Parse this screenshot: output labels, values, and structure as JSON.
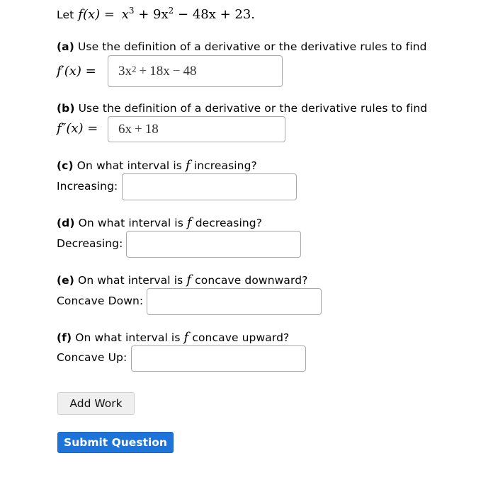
{
  "problem": {
    "intro": "Let",
    "function_lhs": "f(x) =",
    "function_rhs": {
      "t1": "x",
      "t1_exp": "3",
      "t2": "+ 9x",
      "t2_exp": "2",
      "t3": "− 48x + 23."
    }
  },
  "parts": [
    {
      "letter": "(a)",
      "prompt": "Use the definition of a derivative or the derivative rules to find",
      "label": "f′(x) =",
      "answer": {
        "a": "3x",
        "a_exp": "2",
        "op1": "+",
        "b": "18x",
        "op2": "−",
        "c": "48"
      }
    },
    {
      "letter": "(b)",
      "prompt": "Use the definition of a derivative or the derivative rules to find",
      "label": "f″(x) =",
      "answer": {
        "a": "6x",
        "op1": "+",
        "b": "18"
      }
    },
    {
      "letter": "(c)",
      "prompt_pre": "On what interval is",
      "prompt_var": "f",
      "prompt_post": "increasing?",
      "label": "Increasing:",
      "value": ""
    },
    {
      "letter": "(d)",
      "prompt_pre": "On what interval is",
      "prompt_var": "f",
      "prompt_post": "decreasing?",
      "label": "Decreasing:",
      "value": ""
    },
    {
      "letter": "(e)",
      "prompt_pre": "On what interval is",
      "prompt_var": "f",
      "prompt_post": "concave downward?",
      "label": "Concave Down:",
      "value": ""
    },
    {
      "letter": "(f)",
      "prompt_pre": "On what interval is",
      "prompt_var": "f",
      "prompt_post": "concave upward?",
      "label": "Concave Up:",
      "value": ""
    }
  ],
  "buttons": {
    "add_work": "Add Work",
    "submit": "Submit Question"
  },
  "colors": {
    "submit_bg": "#1e73d8",
    "add_work_bg": "#efefef",
    "input_border": "#a9a9a9"
  }
}
